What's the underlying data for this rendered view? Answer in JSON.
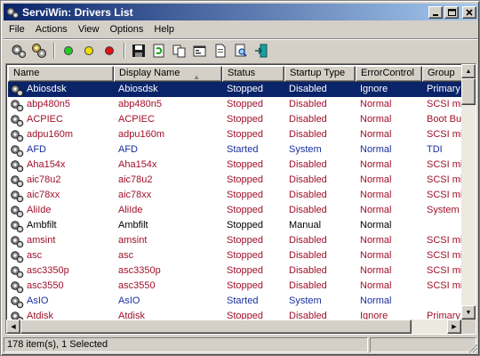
{
  "window": {
    "title": "ServiWin: Drivers List",
    "title_icon": "gears-icon"
  },
  "titlebar_buttons": {
    "minimize": "_",
    "maximize": "□",
    "close": "×"
  },
  "menu": [
    "File",
    "Actions",
    "View",
    "Options",
    "Help"
  ],
  "toolbar": {
    "buttons": [
      "drivers-icon",
      "services-icon",
      "start-green-icon",
      "pause-yellow-icon",
      "stop-red-icon",
      "save-icon",
      "refresh-icon",
      "copy-icon",
      "properties-icon",
      "report-icon",
      "find-icon",
      "exit-icon"
    ]
  },
  "columns": [
    "Name",
    "Display Name",
    "Status",
    "Startup Type",
    "ErrorControl",
    "Group"
  ],
  "sort_column": "Display Name",
  "colors": {
    "stopped": "#a0102a",
    "started": "#1a2fa0",
    "normal_text": "#000000",
    "selection": "#0a246a"
  },
  "rows": [
    {
      "name": "Abiosdsk",
      "display": "Abiosdsk",
      "status": "Stopped",
      "startup": "Disabled",
      "error": "Ignore",
      "group": "Primary d",
      "color": "stopped",
      "selected": true
    },
    {
      "name": "abp480n5",
      "display": "abp480n5",
      "status": "Stopped",
      "startup": "Disabled",
      "error": "Normal",
      "group": "SCSI min",
      "color": "stopped"
    },
    {
      "name": "ACPIEC",
      "display": "ACPIEC",
      "status": "Stopped",
      "startup": "Disabled",
      "error": "Normal",
      "group": "Boot Bus",
      "color": "stopped"
    },
    {
      "name": "adpu160m",
      "display": "adpu160m",
      "status": "Stopped",
      "startup": "Disabled",
      "error": "Normal",
      "group": "SCSI min",
      "color": "stopped"
    },
    {
      "name": "AFD",
      "display": "AFD",
      "status": "Started",
      "startup": "System",
      "error": "Normal",
      "group": "TDI",
      "color": "started"
    },
    {
      "name": "Aha154x",
      "display": "Aha154x",
      "status": "Stopped",
      "startup": "Disabled",
      "error": "Normal",
      "group": "SCSI min",
      "color": "stopped"
    },
    {
      "name": "aic78u2",
      "display": "aic78u2",
      "status": "Stopped",
      "startup": "Disabled",
      "error": "Normal",
      "group": "SCSI min",
      "color": "stopped"
    },
    {
      "name": "aic78xx",
      "display": "aic78xx",
      "status": "Stopped",
      "startup": "Disabled",
      "error": "Normal",
      "group": "SCSI min",
      "color": "stopped"
    },
    {
      "name": "AliIde",
      "display": "AliIde",
      "status": "Stopped",
      "startup": "Disabled",
      "error": "Normal",
      "group": "System B",
      "color": "stopped"
    },
    {
      "name": "Ambfilt",
      "display": "Ambfilt",
      "status": "Stopped",
      "startup": "Manual",
      "error": "Normal",
      "group": "",
      "color": "normal_text"
    },
    {
      "name": "amsint",
      "display": "amsint",
      "status": "Stopped",
      "startup": "Disabled",
      "error": "Normal",
      "group": "SCSI min",
      "color": "stopped"
    },
    {
      "name": "asc",
      "display": "asc",
      "status": "Stopped",
      "startup": "Disabled",
      "error": "Normal",
      "group": "SCSI min",
      "color": "stopped"
    },
    {
      "name": "asc3350p",
      "display": "asc3350p",
      "status": "Stopped",
      "startup": "Disabled",
      "error": "Normal",
      "group": "SCSI min",
      "color": "stopped"
    },
    {
      "name": "asc3550",
      "display": "asc3550",
      "status": "Stopped",
      "startup": "Disabled",
      "error": "Normal",
      "group": "SCSI min",
      "color": "stopped"
    },
    {
      "name": "AsIO",
      "display": "AsIO",
      "status": "Started",
      "startup": "System",
      "error": "Normal",
      "group": "",
      "color": "started"
    },
    {
      "name": "Atdisk",
      "display": "Atdisk",
      "status": "Stopped",
      "startup": "Disabled",
      "error": "Ignore",
      "group": "Primary d",
      "color": "stopped"
    }
  ],
  "status_bar": {
    "count": "178 item(s), 1 Selected"
  }
}
